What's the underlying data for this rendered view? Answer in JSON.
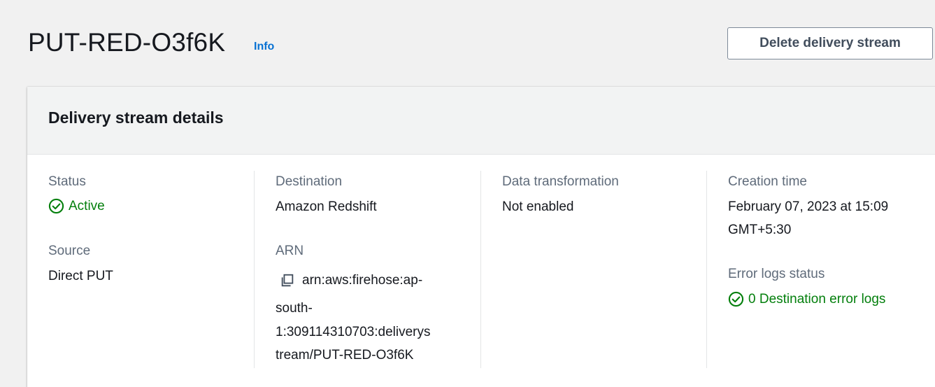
{
  "header": {
    "title": "PUT-RED-O3f6K",
    "info_label": "Info",
    "delete_button_label": "Delete delivery stream"
  },
  "panel": {
    "title": "Delivery stream details",
    "status": {
      "label": "Status",
      "value": "Active",
      "icon": "check-circle-icon"
    },
    "source": {
      "label": "Source",
      "value": "Direct PUT"
    },
    "destination": {
      "label": "Destination",
      "value": "Amazon Redshift"
    },
    "arn": {
      "label": "ARN",
      "lines": [
        "arn:aws:firehose:ap-",
        "south-",
        "1:309114310703:deliverys",
        "tream/PUT-RED-O3f6K"
      ],
      "icon": "copy-icon"
    },
    "data_transformation": {
      "label": "Data transformation",
      "value": "Not enabled"
    },
    "creation_time": {
      "label": "Creation time",
      "lines": [
        "February 07, 2023 at 15:09",
        "GMT+5:30"
      ]
    },
    "error_logs": {
      "label": "Error logs status",
      "value": "0 Destination error logs",
      "icon": "check-circle-icon"
    }
  },
  "colors": {
    "success": "#037f0c",
    "link": "#0972d3",
    "label": "#5f6b7a",
    "text": "#16191f"
  }
}
